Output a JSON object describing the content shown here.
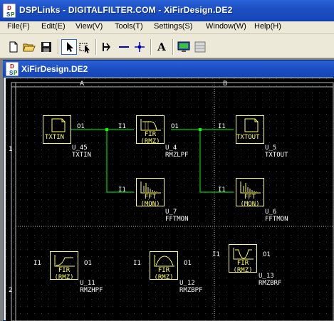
{
  "window": {
    "title": "DSPLinks - DIGITALFILTER.COM - XiFirDesign.DE2",
    "icon": "dsp-app-icon"
  },
  "menu": [
    {
      "label": "File(F)"
    },
    {
      "label": "Edit(E)"
    },
    {
      "label": "View(V)"
    },
    {
      "label": "Tools(T)"
    },
    {
      "label": "Settings(S)"
    },
    {
      "label": "Window(W)"
    },
    {
      "label": "Help(H)"
    }
  ],
  "toolbar": [
    {
      "name": "new-icon"
    },
    {
      "name": "open-folder-icon"
    },
    {
      "name": "save-icon"
    },
    {
      "name": "pointer-icon",
      "pressed": true
    },
    {
      "name": "select-block-icon"
    },
    {
      "name": "wire-tool-icon"
    },
    {
      "name": "horizontal-line-icon"
    },
    {
      "name": "junction-icon"
    },
    {
      "name": "text-icon",
      "label": "A"
    },
    {
      "name": "monitor-icon"
    },
    {
      "name": "grid-icon"
    }
  ],
  "document": {
    "title": "XiFirDesign.DE2"
  },
  "zones": {
    "col_a": "A",
    "col_b": "B",
    "row_1": "1",
    "row_2": "2"
  },
  "blocks": [
    {
      "id": "U_45",
      "type": "TXTIN",
      "caption": "TXTIN",
      "icon": "text-file-icon"
    },
    {
      "id": "U_4",
      "type": "RMZLPF",
      "caption": "FIR\n(RMZ)",
      "icon": "lowpass-icon"
    },
    {
      "id": "U_5",
      "type": "TXTOUT",
      "caption": "TXTOUT",
      "icon": "text-file-icon"
    },
    {
      "id": "U_7",
      "type": "FFTMON",
      "caption": "FFT\n(MON)",
      "icon": "spectrum-icon"
    },
    {
      "id": "U_6",
      "type": "FFTMON",
      "caption": "FFT\n(MON)",
      "icon": "spectrum-icon"
    },
    {
      "id": "U_11",
      "type": "RMZHPF",
      "caption": "FIR\n(RMZ)",
      "icon": "highpass-icon"
    },
    {
      "id": "U_12",
      "type": "RMZBPF",
      "caption": "FIR\n(RMZ)",
      "icon": "bandpass-icon"
    },
    {
      "id": "U_13",
      "type": "RMZBRF",
      "caption": "FIR\n(RMZ)",
      "icon": "bandstop-icon"
    }
  ],
  "ports": {
    "in": "I1",
    "out": "O1"
  },
  "colors": {
    "block_border": "#ffff66",
    "wire": "#00ff00",
    "junction": "#00ff00",
    "canvas": "#000000",
    "grid_dot": "#404040",
    "zone_line": "#c0c0c0"
  }
}
